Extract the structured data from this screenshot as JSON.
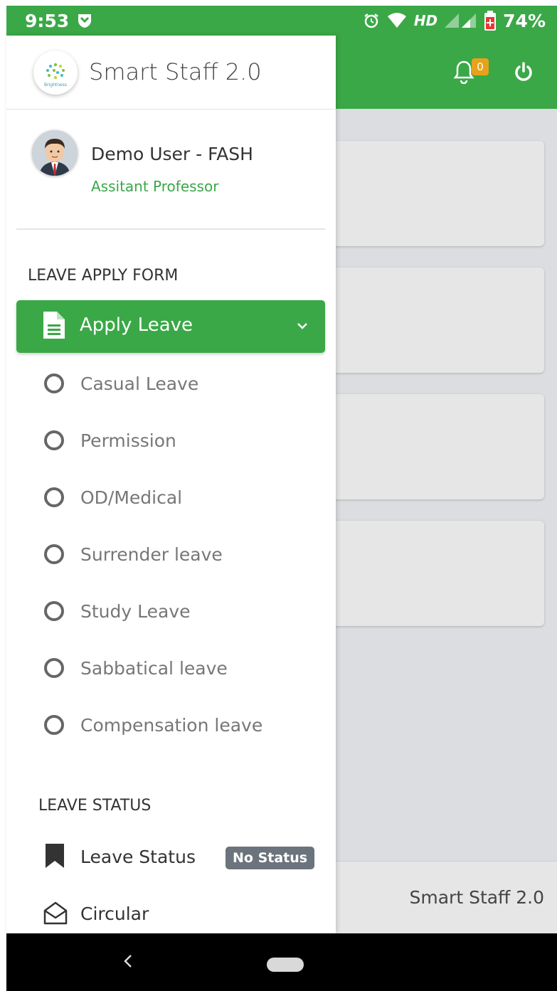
{
  "status_bar": {
    "time": "9:53",
    "network": "HD",
    "battery": "74%"
  },
  "app_header": {
    "notification_count": "0"
  },
  "drawer": {
    "app_title": "Smart Staff 2.0",
    "logo_text": "Brightness",
    "profile": {
      "name": "Demo User - FASH",
      "role": "Assitant Professor"
    },
    "leave_apply_section": "LEAVE APPLY FORM",
    "apply_leave_label": "Apply Leave",
    "leave_types": [
      "Casual Leave",
      "Permission",
      "OD/Medical",
      "Surrender leave",
      "Study Leave",
      "Sabbatical leave",
      "Compensation leave"
    ],
    "leave_status_section": "LEAVE STATUS",
    "leave_status_label": "Leave Status",
    "leave_status_badge": "No Status",
    "circular_label": "Circular"
  },
  "footer": {
    "text": "Smart Staff 2.0"
  },
  "colors": {
    "brand_green": "#3aa847",
    "badge_amber": "#e7a21a",
    "status_badge_gray": "#6b747c"
  }
}
